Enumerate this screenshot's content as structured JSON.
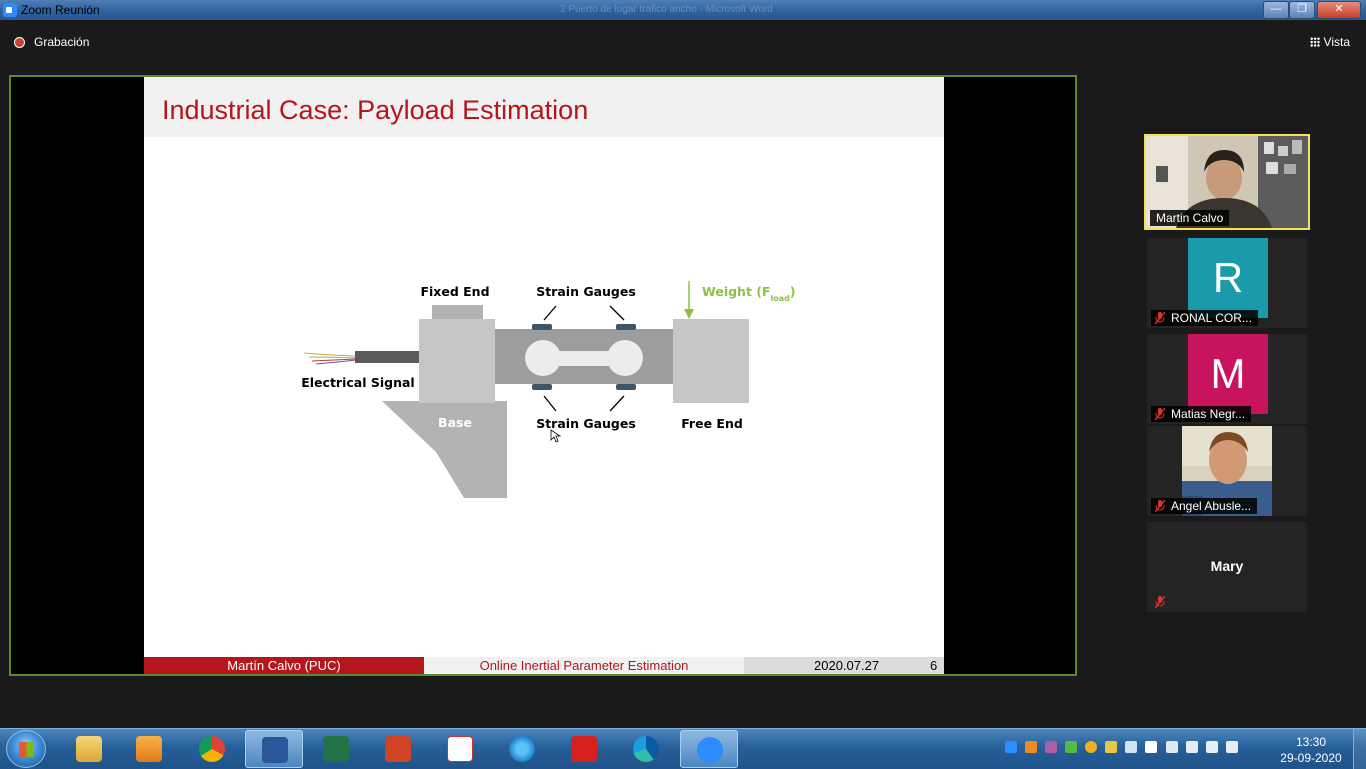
{
  "window": {
    "title": "Zoom Reunión",
    "ghost_title": "2 Puerto de lugar trafico ancho - Microsoft Word",
    "minimize": "—",
    "restore": "❐",
    "close": "✕"
  },
  "topbar": {
    "recording_label": "Grabación",
    "view_label": "Vista"
  },
  "slide": {
    "title": "Industrial Case:  Payload Estimation",
    "diagram": {
      "fixed_end": "Fixed End",
      "strain_gauges_top": "Strain Gauges",
      "strain_gauges_bottom": "Strain Gauges",
      "weight": "Weight (F",
      "weight_sub": "load",
      "weight_close": ")",
      "electrical_signal": "Electrical Signal",
      "base": "Base",
      "free_end": "Free End"
    },
    "footer": {
      "author": "Martín Calvo  (PUC)",
      "title": "Online Inertial Parameter Estimation",
      "date": "2020.07.27",
      "page": "6"
    },
    "colors": {
      "accent": "#b4161b",
      "weight_green": "#8dc04a"
    }
  },
  "participants": [
    {
      "name": "Martin Calvo",
      "type": "video",
      "speaking": true
    },
    {
      "name": "RONAL COR...",
      "initial": "R",
      "color": "#1a9aaa",
      "muted": true
    },
    {
      "name": "Matias Negr...",
      "initial": "M",
      "color": "#c8145e",
      "muted": true
    },
    {
      "name": "Angel Abusle...",
      "type": "video",
      "muted": true
    },
    {
      "name": "Mary",
      "muted": true
    }
  ],
  "taskbar": {
    "apps": [
      "file-explorer",
      "media-player",
      "chrome",
      "word",
      "excel",
      "powerpoint",
      "scielo",
      "internet-explorer",
      "acrobat",
      "edge",
      "zoom"
    ],
    "clock_time": "13:30",
    "clock_date": "29-09-2020"
  }
}
